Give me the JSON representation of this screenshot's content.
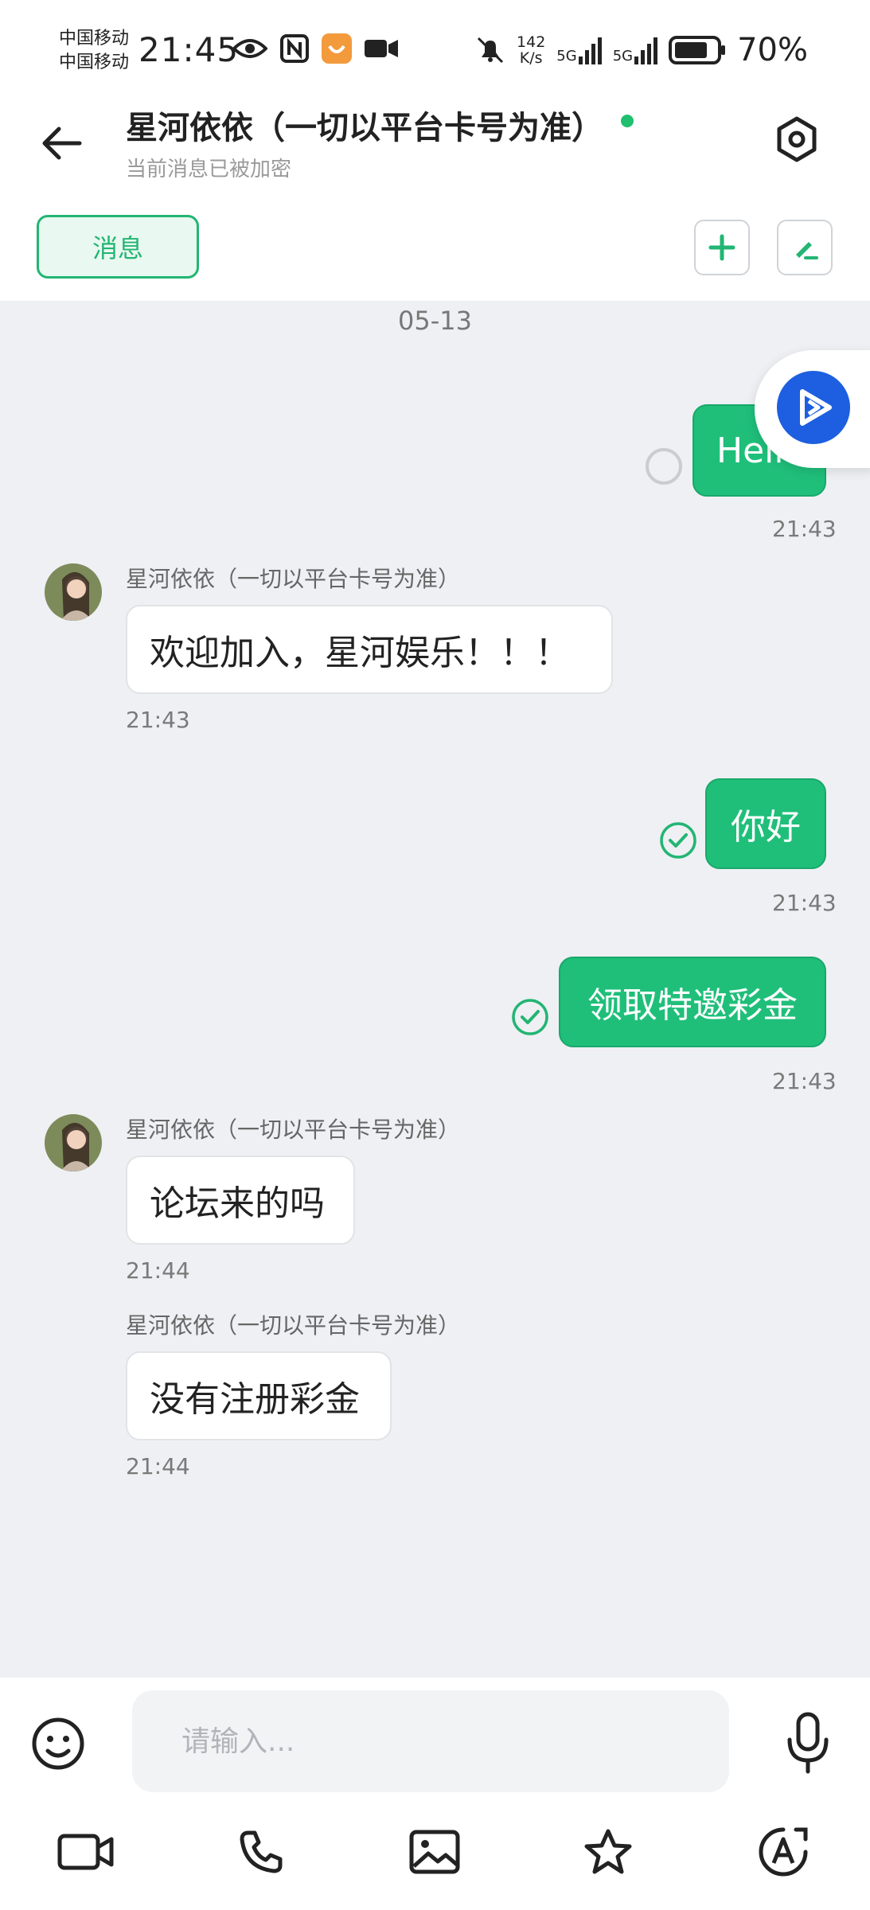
{
  "status_bar": {
    "carrier_1": "中国移动",
    "carrier_2": "中国移动",
    "time": "21:45",
    "speed_value": "142",
    "speed_unit": "K/s",
    "net_1": "5G",
    "net_2": "5G",
    "battery": "70%"
  },
  "header": {
    "title": "星河依依（一切以平台卡号为准）",
    "subtitle": "当前消息已被加密"
  },
  "tabs": {
    "messages": "消息"
  },
  "chat": {
    "date": "05-13",
    "messages": [
      {
        "direction": "out",
        "text": "Hello",
        "time": "21:43",
        "status": "pending"
      },
      {
        "direction": "in",
        "sender": "星河依依（一切以平台卡号为准）",
        "text": "欢迎加入，星河娱乐！！！",
        "time": "21:43"
      },
      {
        "direction": "out",
        "text": "你好",
        "time": "21:43",
        "status": "read"
      },
      {
        "direction": "out",
        "text": "领取特邀彩金",
        "time": "21:43",
        "status": "read"
      },
      {
        "direction": "in",
        "sender": "星河依依（一切以平台卡号为准）",
        "text": "论坛来的吗",
        "time": "21:44"
      },
      {
        "direction": "in",
        "sender": "星河依依（一切以平台卡号为准）",
        "text": "没有注册彩金",
        "time": "21:44"
      }
    ]
  },
  "input": {
    "placeholder": "请输入..."
  },
  "colors": {
    "accent": "#22b573",
    "out_bubble": "#1fbf7a",
    "chat_bg": "#eef0f3"
  },
  "toolbar_icons": [
    "video-icon",
    "phone-icon",
    "image-icon",
    "star-icon",
    "translate-icon"
  ]
}
